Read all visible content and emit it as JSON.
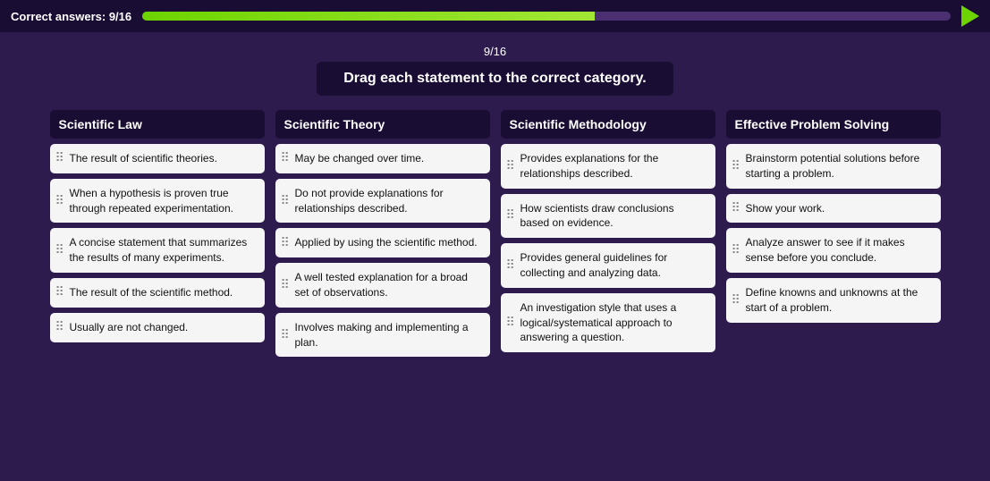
{
  "topBar": {
    "correctAnswers": "Correct answers: 9/16",
    "progressPercent": 56
  },
  "questionHeader": {
    "number": "9/16",
    "instruction": "Drag each statement to the correct category."
  },
  "columns": [
    {
      "id": "scientific-law",
      "header": "Scientific Law",
      "cards": [
        "The result of scientific theories.",
        "When a hypothesis is proven true through repeated experimentation.",
        "A concise statement that summarizes the results of many experiments.",
        "The result of the scientific method.",
        "Usually are not changed."
      ]
    },
    {
      "id": "scientific-theory",
      "header": "Scientific Theory",
      "cards": [
        "May be changed over time.",
        "Do not provide explanations for relationships described.",
        "Applied by using the scientific method.",
        "A well tested explanation for a broad set of observations.",
        "Involves making and implementing a plan."
      ]
    },
    {
      "id": "scientific-methodology",
      "header": "Scientific Methodology",
      "cards": [
        "Provides explanations for the relationships described.",
        "How scientists draw conclusions based on evidence.",
        "Provides general guidelines for collecting and analyzing data.",
        "An investigation style that uses a logical/systematical approach to answering a question."
      ]
    },
    {
      "id": "effective-problem-solving",
      "header": "Effective Problem Solving",
      "cards": [
        "Brainstorm potential solutions before starting a problem.",
        "Show your work.",
        "Analyze answer to see if it makes sense before you conclude.",
        "Define knowns and unknowns at the start of a problem."
      ]
    }
  ]
}
